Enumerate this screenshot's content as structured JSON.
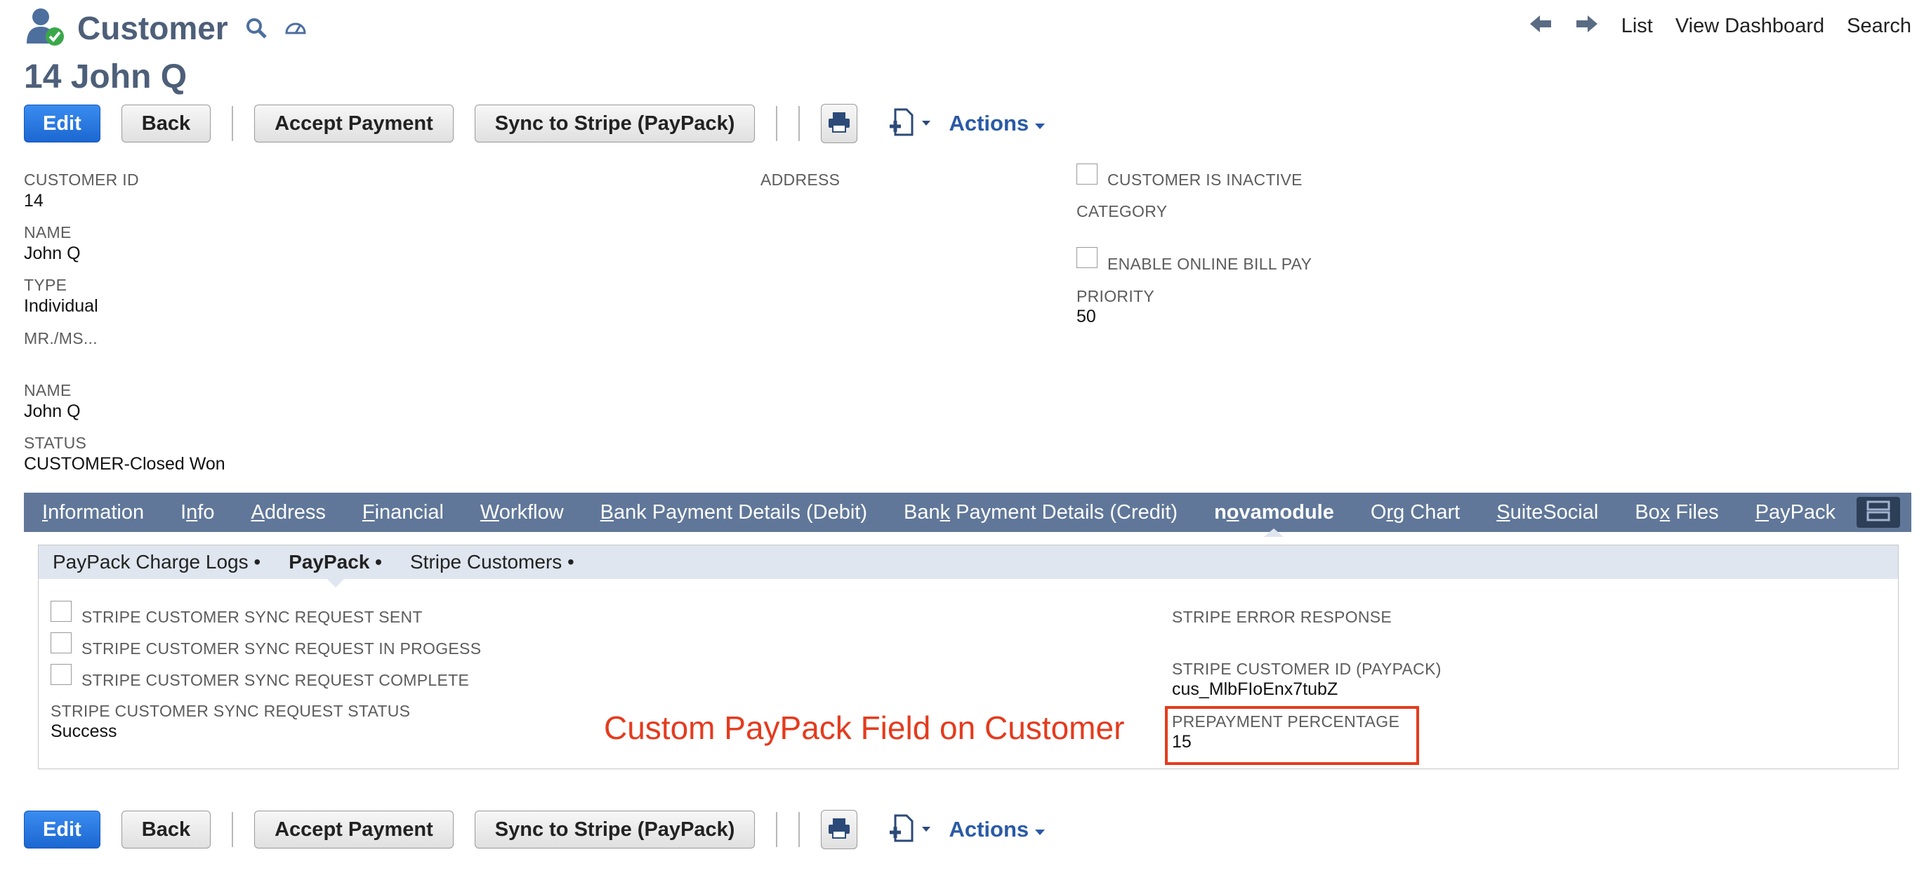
{
  "header": {
    "page_title": "Customer",
    "record_title": "14 John Q",
    "nav": {
      "list": "List",
      "view_dashboard": "View Dashboard",
      "search": "Search"
    }
  },
  "toolbar": {
    "edit": "Edit",
    "back": "Back",
    "accept_payment": "Accept Payment",
    "sync_stripe": "Sync to Stripe (PayPack)",
    "actions": "Actions"
  },
  "fields": {
    "customer_id_label": "CUSTOMER ID",
    "customer_id": "14",
    "name_label": "NAME",
    "name": "John Q",
    "type_label": "TYPE",
    "type": "Individual",
    "mrms_label": "MR./MS...",
    "name2_label": "NAME",
    "name2": "John Q",
    "status_label": "STATUS",
    "status": "CUSTOMER-Closed Won",
    "address_label": "ADDRESS",
    "inactive_label": "CUSTOMER IS INACTIVE",
    "category_label": "CATEGORY",
    "online_bill_label": "ENABLE ONLINE BILL PAY",
    "priority_label": "PRIORITY",
    "priority": "50"
  },
  "tabs": [
    {
      "pre": "",
      "u": "I",
      "post": "nformation"
    },
    {
      "pre": "I",
      "u": "n",
      "post": "fo"
    },
    {
      "pre": "",
      "u": "A",
      "post": "ddress"
    },
    {
      "pre": "",
      "u": "F",
      "post": "inancial"
    },
    {
      "pre": "",
      "u": "W",
      "post": "orkflow"
    },
    {
      "pre": "",
      "u": "B",
      "post": "ank Payment Details (Debit)"
    },
    {
      "pre": "Ban",
      "u": "k",
      "post": " Payment Details (Credit)"
    },
    {
      "pre": "n",
      "u": "o",
      "post": "vamodule"
    },
    {
      "pre": "O",
      "u": "r",
      "post": "g Chart"
    },
    {
      "pre": "",
      "u": "S",
      "post": "uiteSocial"
    },
    {
      "pre": "Bo",
      "u": "x",
      "post": " Files"
    },
    {
      "pre": "",
      "u": "P",
      "post": "ayPack"
    }
  ],
  "subtabs": {
    "charge_logs": "PayPack Charge Logs •",
    "paypack": "PayPack •",
    "stripe_customers": "Stripe Customers •"
  },
  "paypack": {
    "sync_sent": "STRIPE CUSTOMER SYNC REQUEST SENT",
    "sync_progress": "STRIPE CUSTOMER SYNC REQUEST IN PROGESS",
    "sync_complete": "STRIPE CUSTOMER SYNC REQUEST COMPLETE",
    "sync_status_label": "STRIPE CUSTOMER SYNC REQUEST STATUS",
    "sync_status": "Success",
    "error_label": "STRIPE ERROR RESPONSE",
    "stripe_id_label": "STRIPE CUSTOMER ID (PAYPACK)",
    "stripe_id": "cus_MlbFIoEnx7tubZ",
    "prepay_label": "PREPAYMENT PERCENTAGE",
    "prepay": "15"
  },
  "annotation": "Custom PayPack Field on Customer",
  "colors": {
    "accent": "#4d5f79",
    "tabbar": "#607799",
    "primary": "#1c67d1",
    "annotation": "#e43b1e"
  }
}
